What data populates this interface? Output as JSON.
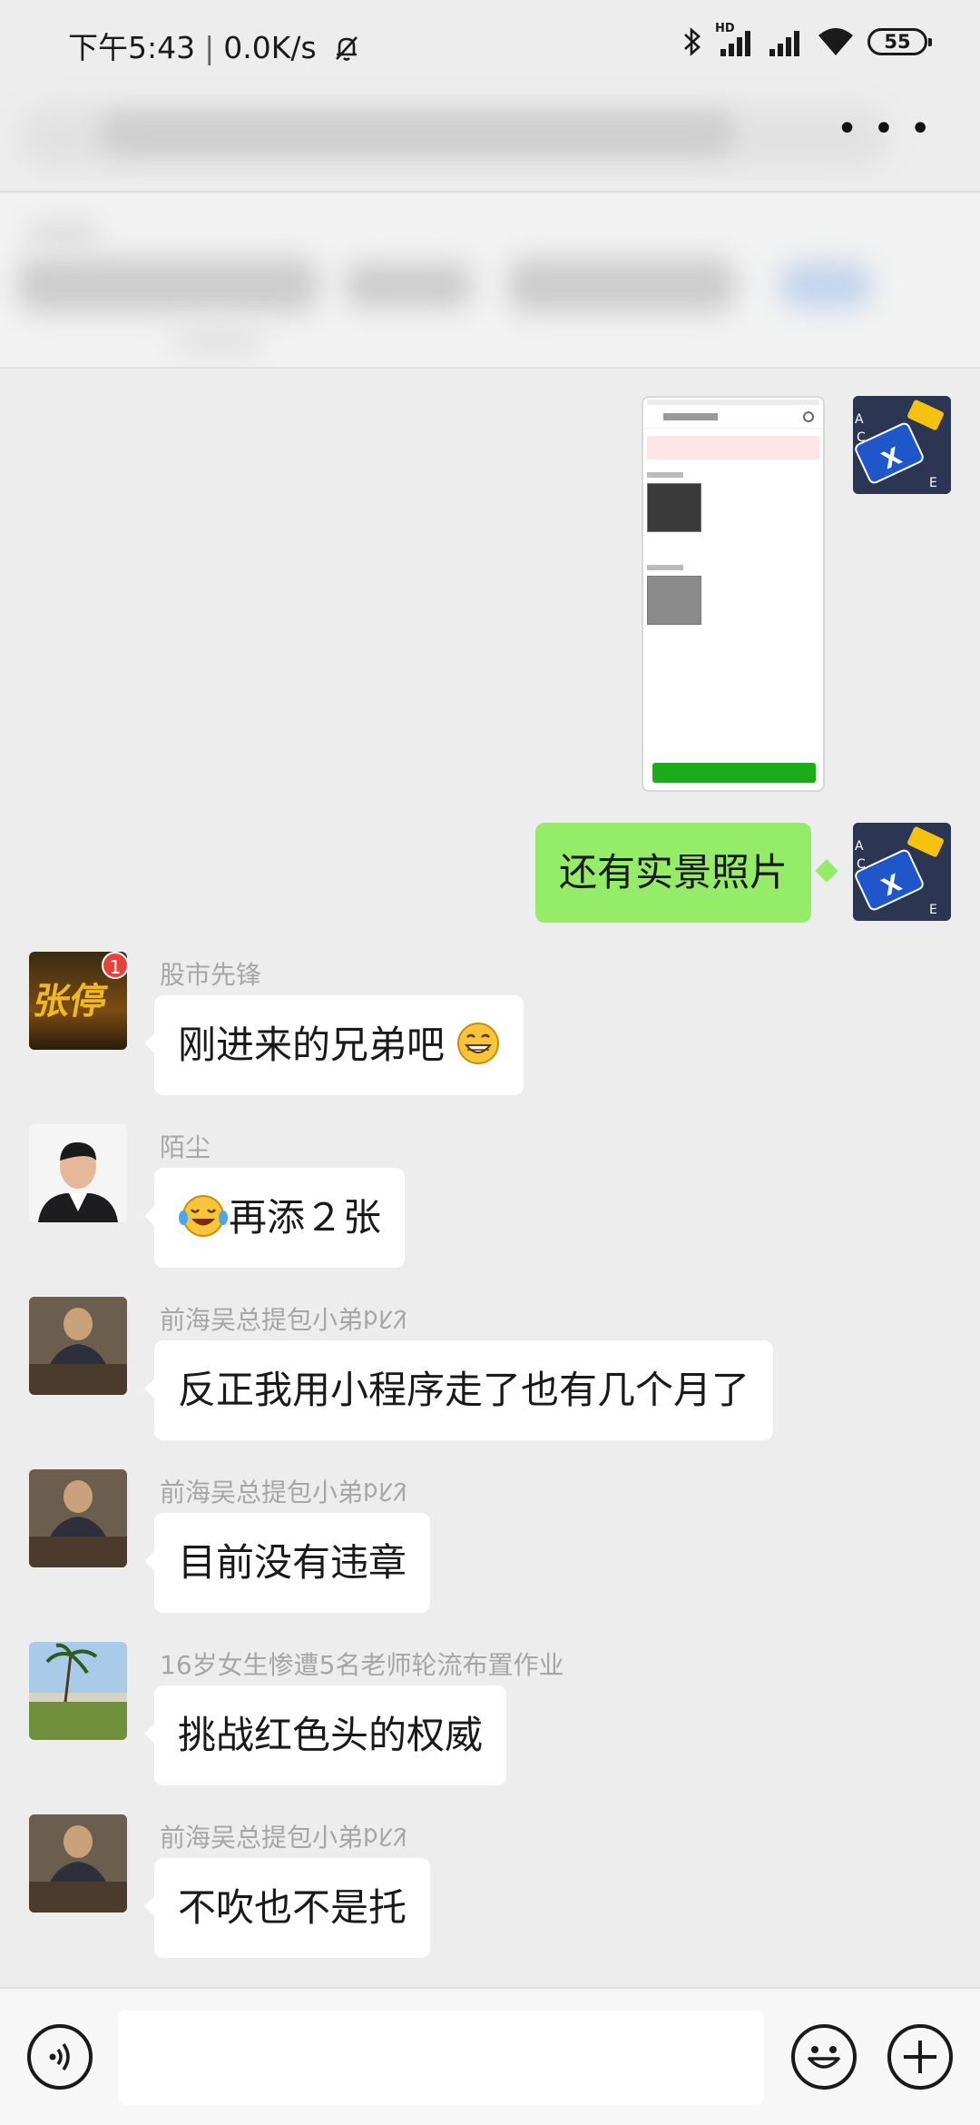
{
  "status": {
    "time": "下午5:43",
    "speed": "0.0K/s",
    "battery": "55",
    "hd": "HD"
  },
  "messages": [
    {
      "sender": "股市先锋",
      "text": "刚进来的兄弟吧",
      "avatar_text": "张停"
    },
    {
      "sender": "陌尘",
      "text": "再添２张"
    },
    {
      "sender": "前海吴总提包小弟ᱞᱥᱤ",
      "text": "反正我用小程序走了也有几个月了"
    },
    {
      "sender": "前海吴总提包小弟ᱞᱥᱤ",
      "text": "目前没有违章"
    },
    {
      "sender": "16岁女生惨遭5名老师轮流布置作业",
      "text": "挑战红色头的权威"
    },
    {
      "sender": "前海吴总提包小弟ᱞᱥᱤ",
      "text": "不吹也不是托"
    }
  ],
  "my_messages": [
    {
      "text": "还有实景照片"
    }
  ],
  "badge": "1",
  "colors": {
    "my_bubble": "#95ec69",
    "bg": "#ededed",
    "badge": "#e64340"
  }
}
